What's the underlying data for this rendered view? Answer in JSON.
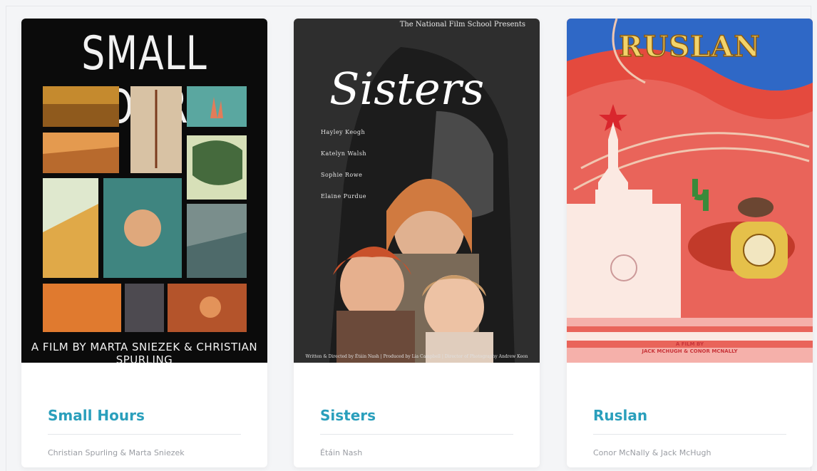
{
  "cards": [
    {
      "title": "Small Hours",
      "credit": "Christian Spurling & Marta Sniezek",
      "poster": {
        "title": "SMALL HOURS",
        "credit": "A FILM BY MARTA SNIEZEK & CHRISTIAN SPURLING"
      }
    },
    {
      "title": "Sisters",
      "credit": "Étáin Nash",
      "poster": {
        "presents": "The National Film School Presents",
        "title": "Sisters",
        "cast": [
          "Hayley Keogh",
          "Katelyn Walsh",
          "Sophie Rowe",
          "Elaine Purdue"
        ],
        "billing": "Written & Directed by Étáin Nash | Produced by Lia Campbell | Director of Photography Andrew Keon"
      }
    },
    {
      "title": "Ruslan",
      "credit": "Conor McNally & Jack McHugh",
      "poster": {
        "title": "RUSLAN",
        "credit_line1": "A FILM BY",
        "credit_line2": "JACK MCHUGH & CONOR MCNALLY"
      }
    }
  ],
  "colors": {
    "accent": "#2a9fbc",
    "muted": "#9a9da3",
    "background": "#f4f5f7"
  }
}
